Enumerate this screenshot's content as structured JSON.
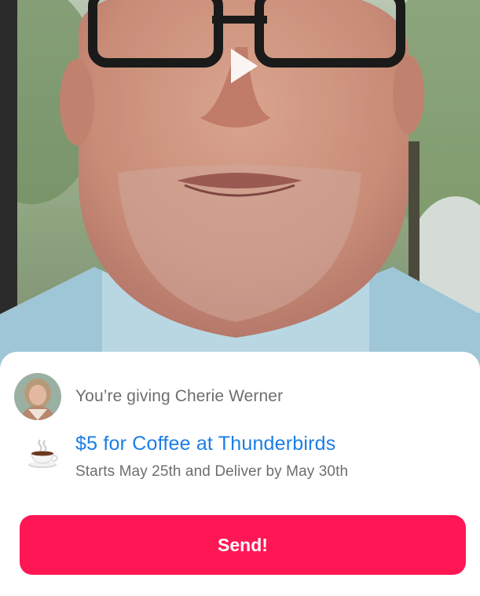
{
  "video": {
    "play_icon": "play-icon",
    "accent_color": "#ffffff"
  },
  "recipient": {
    "text": "You’re giving Cherie Werner",
    "avatar_icon": "avatar"
  },
  "gift": {
    "icon": "coffee-cup-icon",
    "title": "$5 for Coffee at Thunderbirds",
    "subtitle": "Starts May 25th and Deliver by May 30th",
    "title_color": "#1b7ee6"
  },
  "actions": {
    "send_label": "Send!",
    "send_color": "#ff1654"
  }
}
